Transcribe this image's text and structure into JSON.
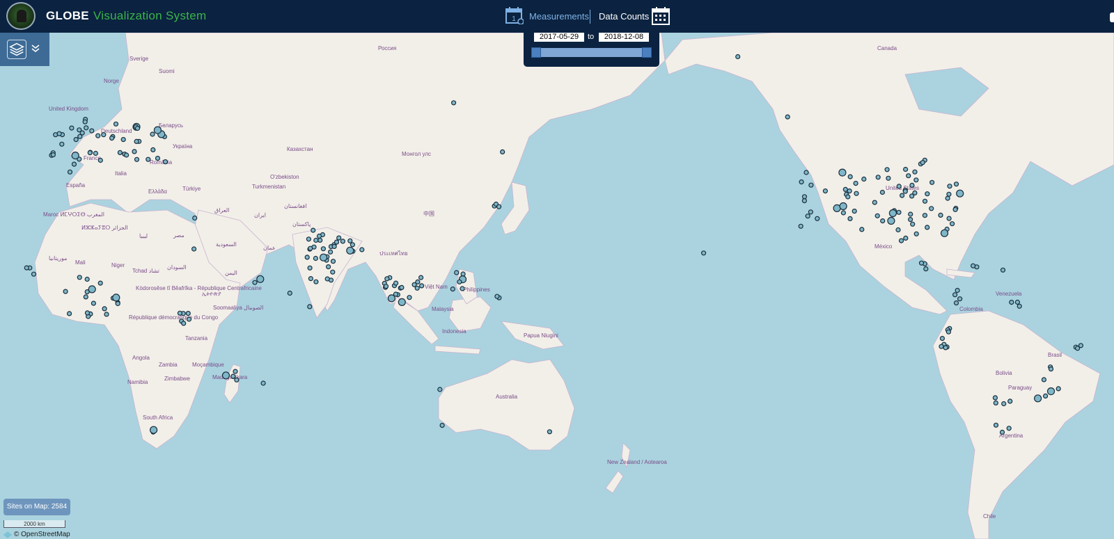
{
  "header": {
    "brand_main": "GLOBE",
    "brand_sub": "Visualization System",
    "calendar_day": "1",
    "measurements_label": "Measurements",
    "data_counts_label": "Data Counts"
  },
  "date_filter": {
    "start": "2017-05-29",
    "end": "2018-12-08",
    "to_label": "to"
  },
  "map_labels": [
    "Россия",
    "Canada",
    "Sverige",
    "Suomi",
    "Norge",
    "United Kingdom",
    "Deutschland",
    "Беларусь",
    "Україна",
    "France",
    "România",
    "España",
    "Italia",
    "Ελλάδα",
    "Türkiye",
    "Maroc ⵍⵎⵖⵔⵉⴱ المغرب",
    "ⵍⵣⵣⴰⵢⴻⵔ الجزائر",
    "ليبيا",
    "مصر",
    "Mali",
    "Niger",
    "Tchad تشاد",
    "السودان",
    "موريتانيا",
    "Kòdorosêse tî Bêafrîka - République Centrafricaine",
    "ኢትዮጵያ",
    "Soomaaliya الصومال",
    "République démocratique du Congo",
    "Tanzania",
    "Angola",
    "Zambia",
    "Moçambique",
    "Namibia",
    "Zimbabwe",
    "Madagasikara",
    "South Africa",
    "Казахстан",
    "O'zbekiston",
    "Turkmenistan",
    "Монгол улс",
    "ایران",
    "العراق",
    "السعودية",
    "اليمن",
    "عمان",
    "افغانستان",
    "پاکستان",
    "中国",
    "Việt Nam",
    "Philippines",
    "Malaysia",
    "Indonesia",
    "Papua Niugini",
    "Australia",
    "New Zealand / Aotearoa",
    "United States",
    "México",
    "Venezuela",
    "Colombia",
    "Brasil",
    "Bolivia",
    "Paraguay",
    "Argentina",
    "Chile",
    "ประเทศไทย"
  ],
  "map_status": {
    "sites_on_map": "Sites on Map: 2584",
    "scale_label": "2000 km",
    "attribution": "© OpenStreetMap"
  },
  "icons": {
    "logo": "globe-logo",
    "calendar": "calendar-icon",
    "data_counts": "calendar-grid-icon",
    "layers": "layers-icon",
    "chevron": "chevron-down-icon",
    "osm": "osm-diamond-icon"
  },
  "colors": {
    "header_bg": "#0b2340",
    "brand_accent": "#3cb44b",
    "ocean": "#aad3df",
    "land": "#f2efe9",
    "site_fill": "#7fb7c9",
    "site_stroke": "#1b2d3a"
  }
}
